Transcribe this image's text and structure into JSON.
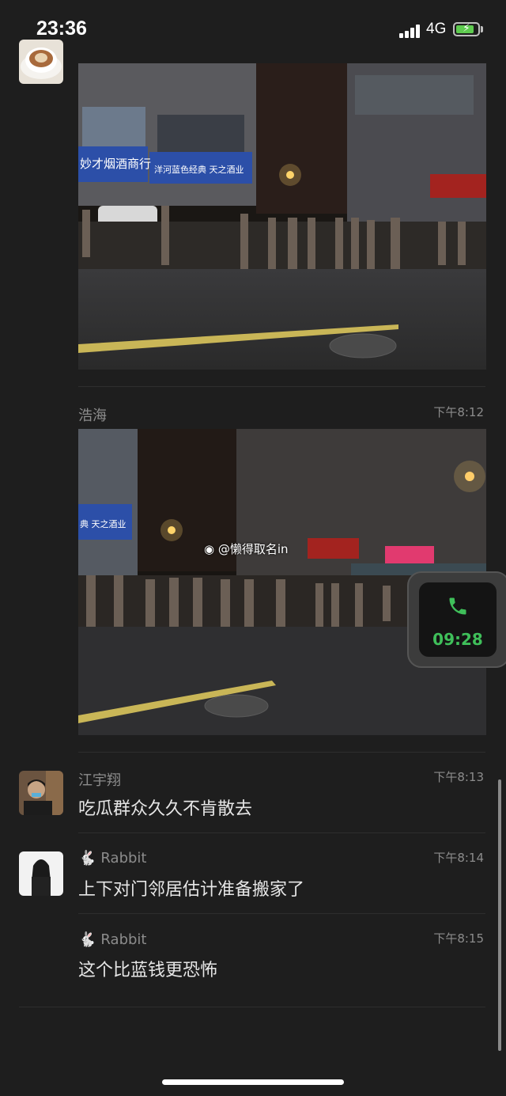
{
  "status_bar": {
    "time": "23:36",
    "network": "4G"
  },
  "messages": [
    {
      "name": "浩海",
      "time": "下午8:12"
    },
    {
      "name": "江宇翔",
      "time": "下午8:13",
      "text": "吃瓜群众久久不肯散去"
    },
    {
      "name": "Rabbit",
      "time": "下午8:14",
      "text": "上下对门邻居估计准备搬家了"
    },
    {
      "name": "Rabbit",
      "time": "下午8:15",
      "text": "这个比蓝钱更恐怖"
    }
  ],
  "photo1": {
    "shop_sign_1": "妙才烟酒商行",
    "shop_sign_2": "洋河蓝色经典 天之酒业"
  },
  "photo2": {
    "shop_sign": "典 天之酒业",
    "watermark": "@懒得取名in"
  },
  "call": {
    "duration": "09:28"
  },
  "icons": {
    "call": "phone-icon",
    "rabbit": "rabbit-emoji",
    "weibo": "weibo-icon"
  },
  "colors": {
    "background": "#1e1e1e",
    "call_green": "#3fbf5a",
    "battery_green": "#5ecb4f"
  }
}
